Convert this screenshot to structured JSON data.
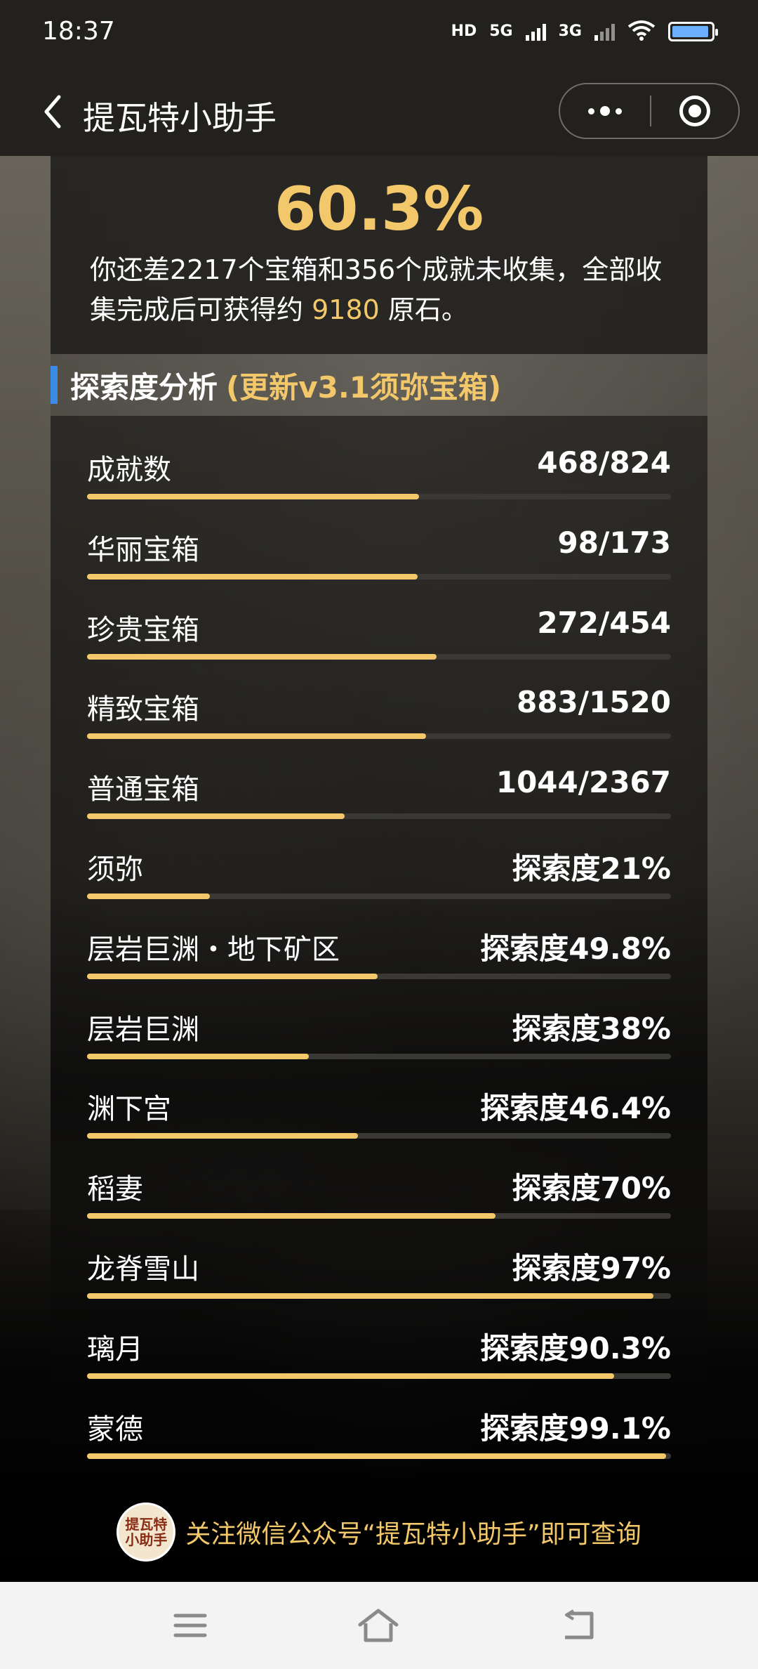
{
  "status_bar": {
    "time": "18:37",
    "hd": "HD",
    "net1": "5G",
    "net2": "3G"
  },
  "nav": {
    "title": "提瓦特小助手"
  },
  "summary": {
    "percent": "60.3%",
    "text_part1": "你还差2217个宝箱和356个成就未收集，全部收集完成后可获得约 ",
    "primogems": "9180",
    "text_part2": " 原石。"
  },
  "section": {
    "title": "探索度分析",
    "subtitle": "(更新v3.1须弥宝箱)"
  },
  "rows": [
    {
      "label": "成就数",
      "value": "468/824",
      "progress": 0.568
    },
    {
      "label": "华丽宝箱",
      "value": "98/173",
      "progress": 0.566
    },
    {
      "label": "珍贵宝箱",
      "value": "272/454",
      "progress": 0.599
    },
    {
      "label": "精致宝箱",
      "value": "883/1520",
      "progress": 0.581
    },
    {
      "label": "普通宝箱",
      "value": "1044/2367",
      "progress": 0.441
    },
    {
      "label": "须弥",
      "value": "探索度21%",
      "progress": 0.21
    },
    {
      "label": "层岩巨渊・地下矿区",
      "value": "探索度49.8%",
      "progress": 0.498
    },
    {
      "label": "层岩巨渊",
      "value": "探索度38%",
      "progress": 0.38
    },
    {
      "label": "渊下宫",
      "value": "探索度46.4%",
      "progress": 0.464
    },
    {
      "label": "稻妻",
      "value": "探索度70%",
      "progress": 0.7
    },
    {
      "label": "龙脊雪山",
      "value": "探索度97%",
      "progress": 0.97
    },
    {
      "label": "璃月",
      "value": "探索度90.3%",
      "progress": 0.903
    },
    {
      "label": "蒙德",
      "value": "探索度99.1%",
      "progress": 0.991
    }
  ],
  "footer": {
    "logo_line1": "提瓦特",
    "logo_line2": "小助手",
    "text": "关注微信公众号“提瓦特小助手”即可查询"
  },
  "icons": {
    "back": "chevron-left-icon",
    "more": "more-dots-icon",
    "close": "target-circle-icon",
    "menu": "menu-icon",
    "home": "home-icon",
    "return": "return-icon"
  },
  "colors": {
    "accent": "#f3c86a",
    "section_bar": "#3a8be6",
    "track": "#3a3834"
  }
}
